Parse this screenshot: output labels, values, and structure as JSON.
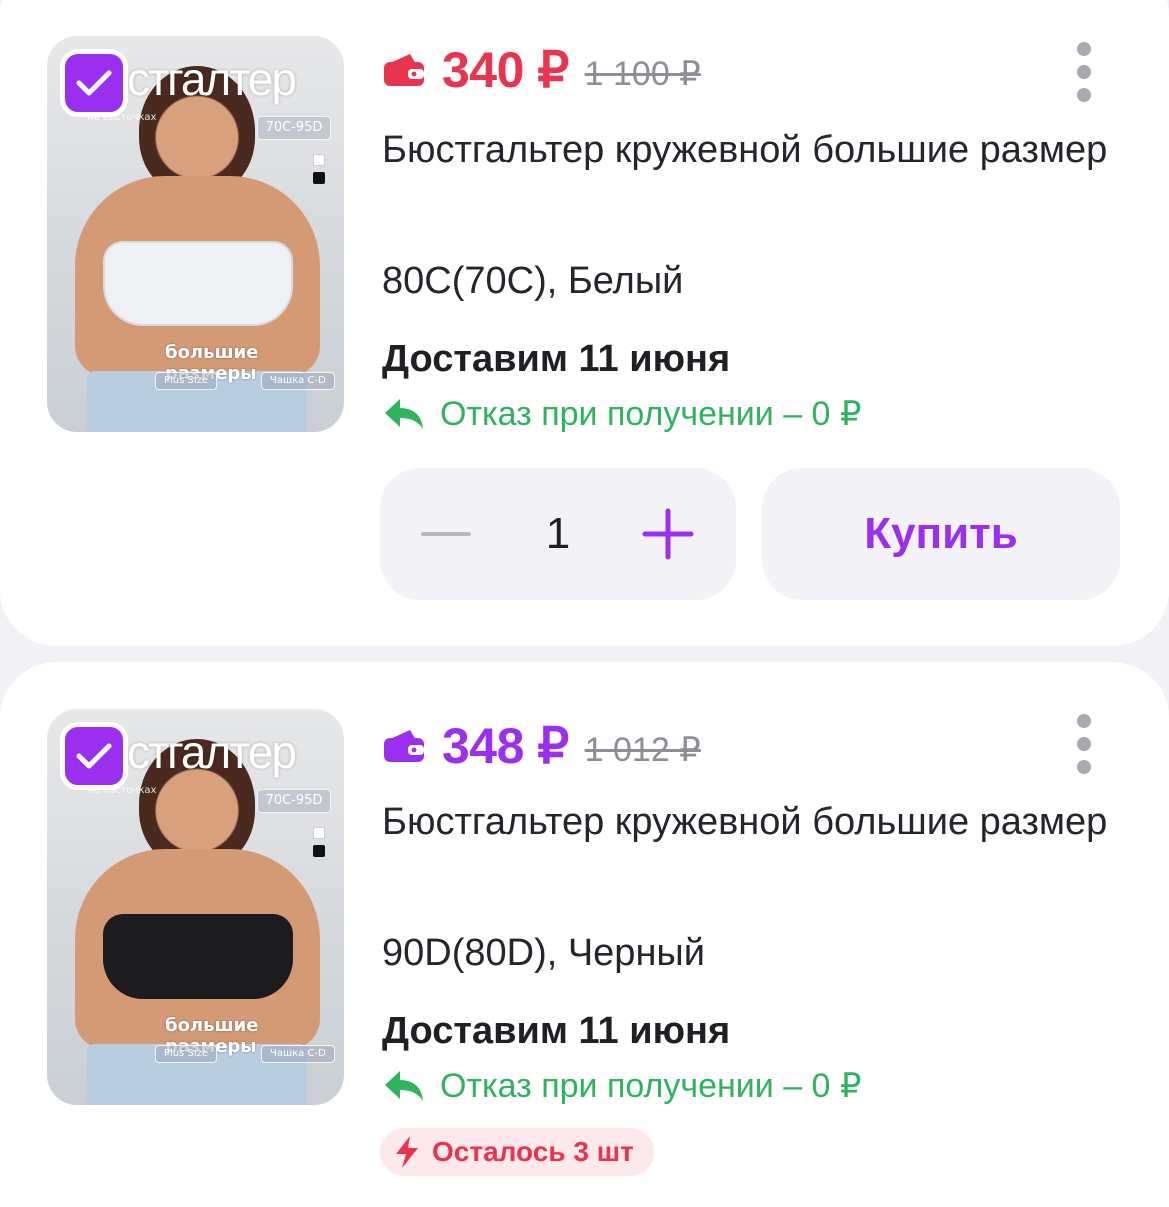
{
  "colors": {
    "accent_purple": "#9b2ff0",
    "price_red": "#e8344e",
    "refund_green": "#2fb35e",
    "stock_badge_bg": "#fde8ec"
  },
  "products": [
    {
      "selected": true,
      "image": {
        "title": "стгалтер",
        "subtitle": "на косточках",
        "size_tag": "70C-95D",
        "caption": "большие размеры",
        "tag_1": "Plus Size",
        "tag_2": "Чашка C-D"
      },
      "price": "340 ₽",
      "price_color": "#e8344e",
      "old_price": "1 100 ₽",
      "title": "Бюстгальтер кружевной большие размер",
      "variant": "80C(70C), Белый",
      "delivery": "Доставим 11 июня",
      "refund": "Отказ при получении – 0 ₽",
      "quantity": "1",
      "buy_label": "Купить"
    },
    {
      "selected": true,
      "image": {
        "title": "стгалтер",
        "subtitle": "на косточках",
        "size_tag": "70C-95D",
        "caption": "большие размеры",
        "tag_1": "Plus Size",
        "tag_2": "Чашка C-D"
      },
      "price": "348 ₽",
      "price_color": "#9b2ff0",
      "old_price": "1 012 ₽",
      "title": "Бюстгальтер кружевной большие размер",
      "variant": "90D(80D), Черный",
      "delivery": "Доставим 11 июня",
      "refund": "Отказ при получении – 0 ₽",
      "stock": "Осталось 3 шт"
    }
  ]
}
